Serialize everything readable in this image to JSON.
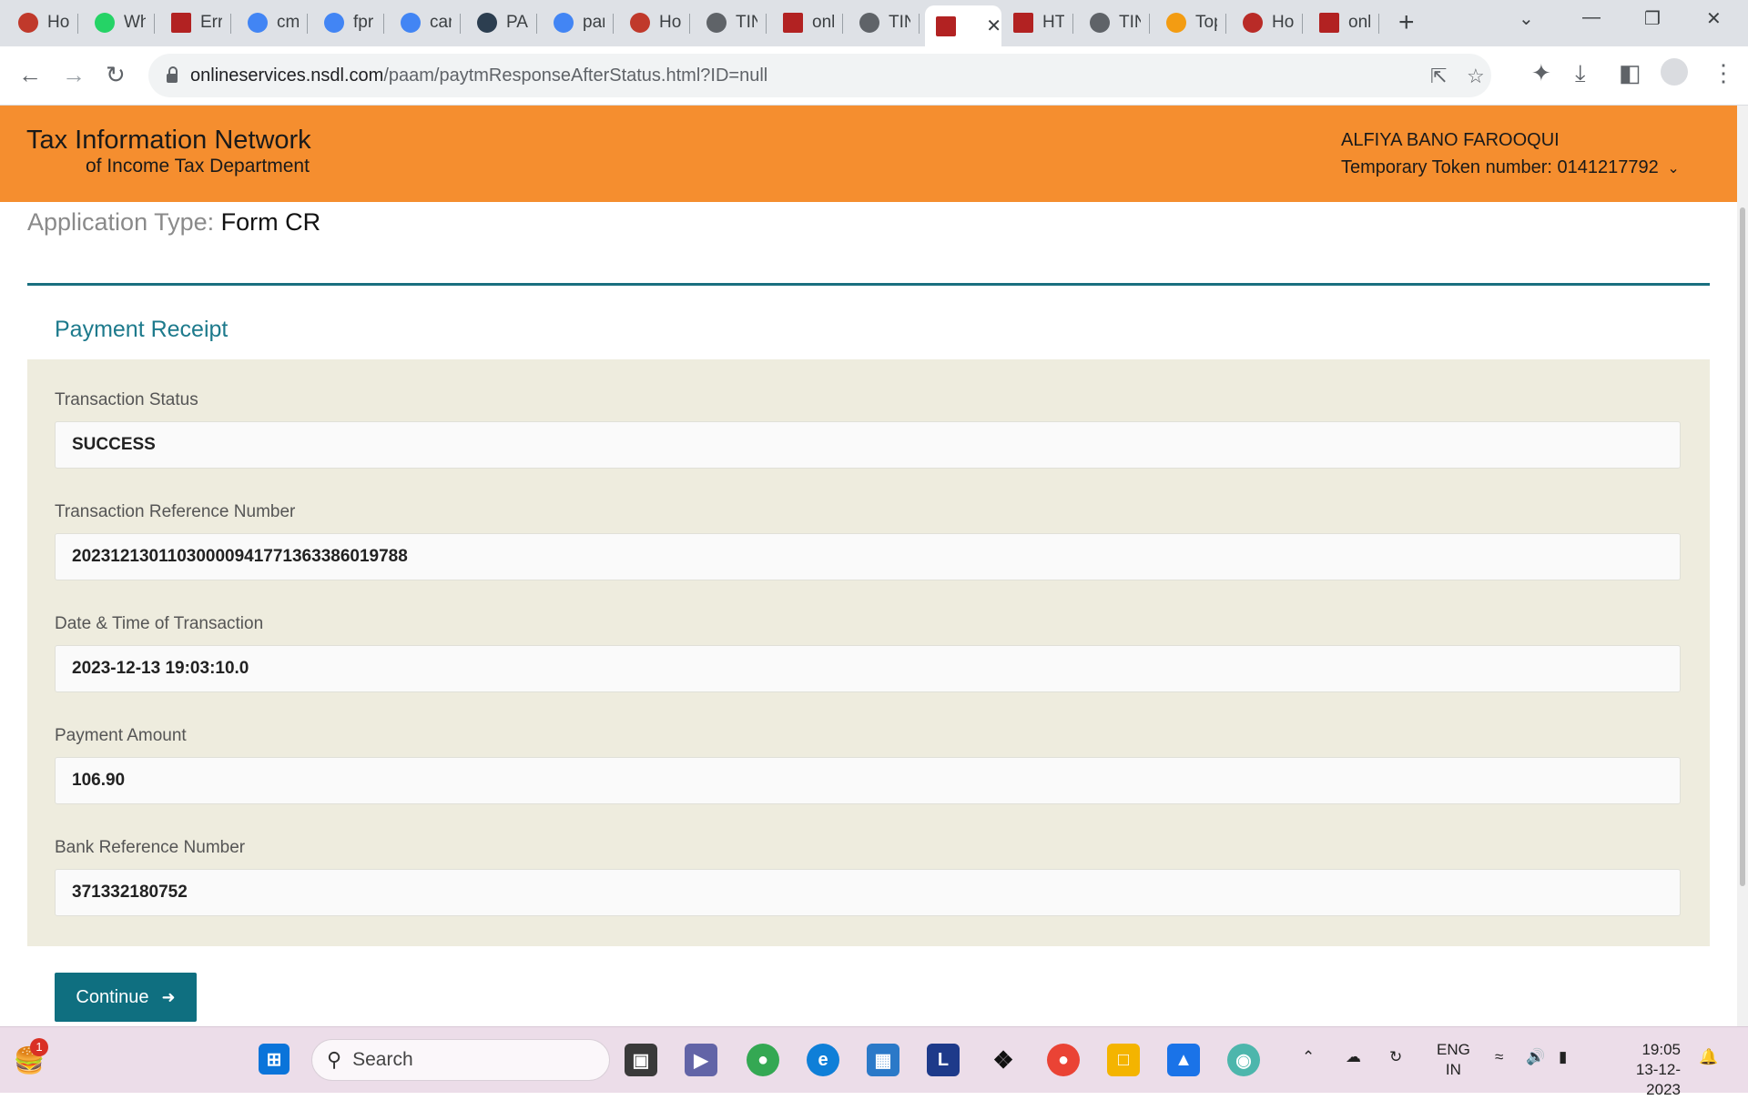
{
  "browser": {
    "tabs": [
      {
        "title": "Ho",
        "icon": "nsdl-people-icon",
        "color": "#c0392b"
      },
      {
        "title": "Wh",
        "icon": "whatsapp-icon",
        "color": "#25d366"
      },
      {
        "title": "Err",
        "icon": "nsdl-logo-icon",
        "color": "#b22222"
      },
      {
        "title": "cm",
        "icon": "google-icon",
        "color": "#4285f4"
      },
      {
        "title": "fpr",
        "icon": "google-icon",
        "color": "#4285f4"
      },
      {
        "title": "car",
        "icon": "google-icon",
        "color": "#4285f4"
      },
      {
        "title": "PA",
        "icon": "cleartax-icon",
        "color": "#2c3e50"
      },
      {
        "title": "par",
        "icon": "google-icon",
        "color": "#4285f4"
      },
      {
        "title": "Ho",
        "icon": "nsdl-people-icon",
        "color": "#c0392b"
      },
      {
        "title": "TIN",
        "icon": "globe-icon",
        "color": "#5f6368"
      },
      {
        "title": "onl",
        "icon": "nsdl-logo-icon",
        "color": "#b22222"
      },
      {
        "title": "TIN",
        "icon": "globe-icon",
        "color": "#5f6368"
      },
      {
        "title": "",
        "icon": "nsdl-logo-icon",
        "color": "#b22222",
        "active": true
      },
      {
        "title": "HT",
        "icon": "nsdl-logo-icon",
        "color": "#b22222"
      },
      {
        "title": "TIN",
        "icon": "globe-icon",
        "color": "#5f6368"
      },
      {
        "title": "Top",
        "icon": "justdial-icon",
        "color": "#f39c12"
      },
      {
        "title": "Ho",
        "icon": "quora-icon",
        "color": "#b92b27"
      },
      {
        "title": "onl",
        "icon": "nsdl-logo-icon",
        "color": "#b22222"
      }
    ],
    "url_host": "onlineservices.nsdl.com",
    "url_path": "/paam/paytmResponseAfterStatus.html?ID=null"
  },
  "header": {
    "brand_line1": "Tax Information Network",
    "brand_line2": "of Income Tax Department",
    "user_name": "ALFIYA BANO FAROOQUI",
    "token_text": "Temporary Token number: 0141217792",
    "accent_color": "#f58e2f"
  },
  "application": {
    "type_label": "Application Type:",
    "type_value": "Form CR"
  },
  "receipt": {
    "title": "Payment Receipt",
    "fields": [
      {
        "label": "Transaction Status",
        "value": "SUCCESS"
      },
      {
        "label": "Transaction Reference Number",
        "value": "20231213011030000941771363386019788"
      },
      {
        "label": "Date & Time of Transaction",
        "value": "2023-12-13 19:03:10.0"
      },
      {
        "label": "Payment Amount",
        "value": "106.90"
      },
      {
        "label": "Bank Reference Number",
        "value": "371332180752"
      }
    ],
    "continue_label": "Continue"
  },
  "taskbar": {
    "search_label": "Search",
    "notification_count": "1",
    "lang_line1": "ENG",
    "lang_line2": "IN",
    "time": "19:05",
    "date": "13-12-2023"
  }
}
